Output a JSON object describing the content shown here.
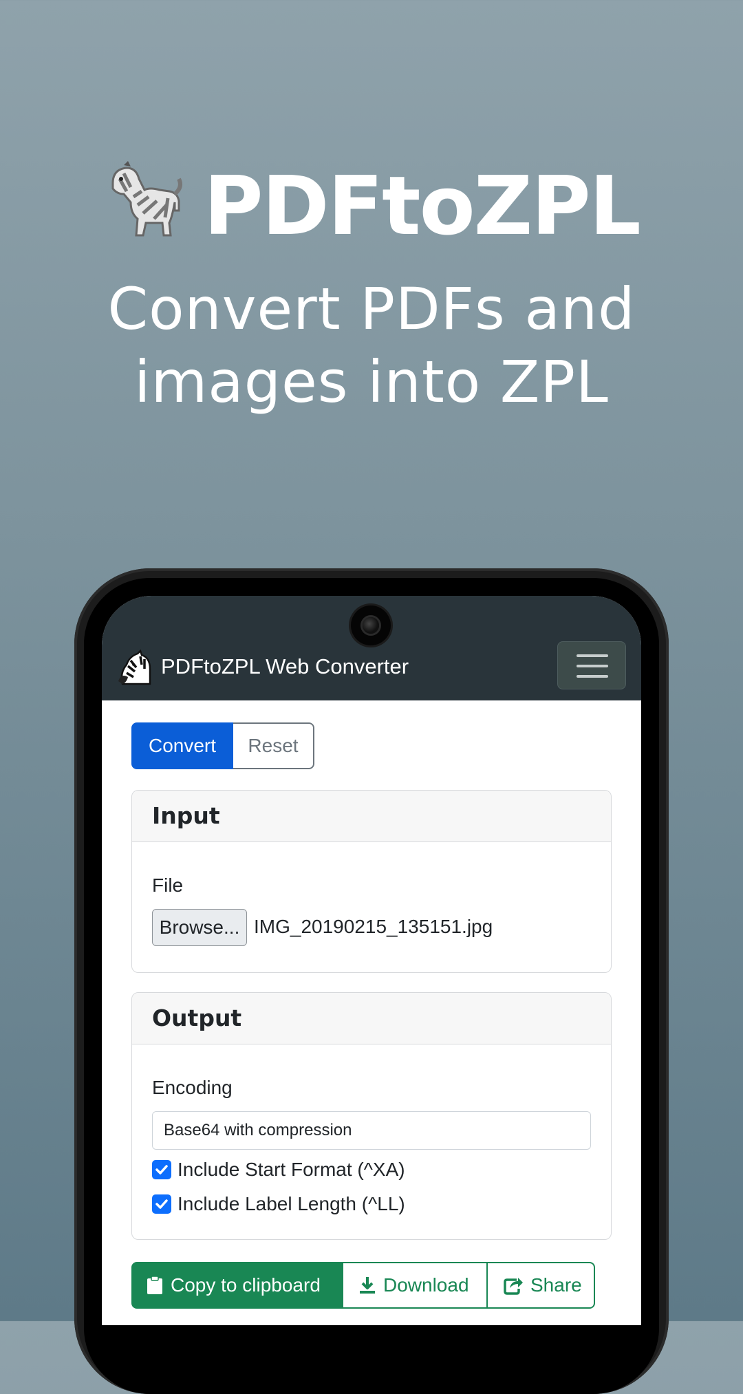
{
  "hero": {
    "title": "PDFtoZPL",
    "subtitle": "Convert PDFs and images into ZPL",
    "icon": "zebra-icon"
  },
  "navbar": {
    "brand": "PDFtoZPL Web Converter",
    "logo_icon": "zebra-head-icon",
    "toggler_icon": "hamburger-menu-icon",
    "background": "#29343a"
  },
  "tabs": {
    "convert": "Convert",
    "reset": "Reset",
    "active": "Convert"
  },
  "input_card": {
    "title": "Input",
    "file_label": "File",
    "browse_label": "Browse...",
    "file_name": "IMG_20190215_135151.jpg"
  },
  "output_card": {
    "title": "Output",
    "encoding_label": "Encoding",
    "encoding_value": "Base64 with compression",
    "options": [
      {
        "label": "Include Start Format (^XA)",
        "checked": true
      },
      {
        "label": "Include Label Length (^LL)",
        "checked": true
      }
    ]
  },
  "actions": {
    "copy": "Copy to clipboard",
    "download": "Download",
    "share": "Share"
  },
  "colors": {
    "primary": "#0b5ed7",
    "success": "#198754",
    "checkbox": "#0d6efd"
  }
}
